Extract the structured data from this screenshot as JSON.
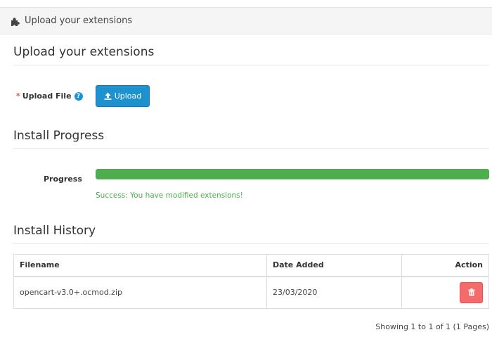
{
  "header": {
    "icon": "puzzle-icon",
    "title": "Upload your extensions"
  },
  "upload_section": {
    "title": "Upload your extensions",
    "required_mark": "*",
    "field_label": "Upload File",
    "help_icon": "question-circle-icon",
    "help_glyph": "?",
    "button_icon": "upload-icon",
    "button_label": "Upload",
    "button_color": "#1e91cf"
  },
  "progress_section": {
    "title": "Install Progress",
    "label": "Progress",
    "percent": 100,
    "bar_color": "#4cae4c",
    "message": "Success: You have modified extensions!"
  },
  "history_section": {
    "title": "Install History",
    "columns": {
      "filename": "Filename",
      "date_added": "Date Added",
      "action": "Action"
    },
    "rows": [
      {
        "filename": "opencart-v3.0+.ocmod.zip",
        "date_added": "23/03/2020",
        "action_icon": "trash-icon"
      }
    ],
    "delete_color": "#f56b6b",
    "pagination": "Showing 1 to 1 of 1 (1 Pages)"
  }
}
